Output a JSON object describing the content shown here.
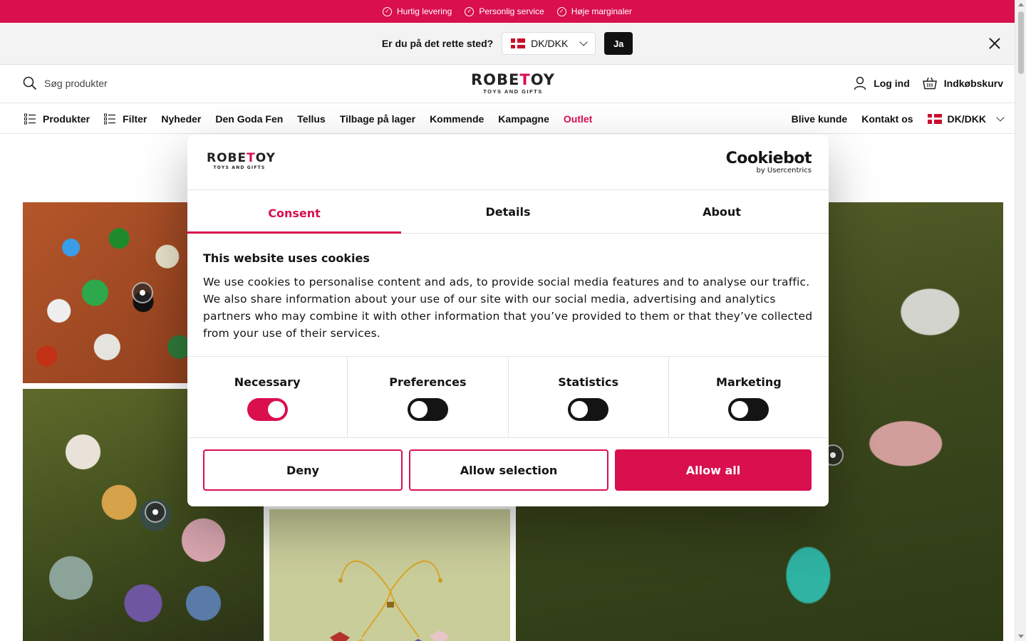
{
  "promo": {
    "items": [
      "Hurtig levering",
      "Personlig service",
      "Høje marginaler"
    ]
  },
  "locale_bar": {
    "question": "Er du på det rette sted?",
    "selected": "DK/DKK",
    "confirm": "Ja"
  },
  "header": {
    "search_placeholder": "Søg produkter",
    "logo_main_left": "ROBE",
    "logo_main_t": "T",
    "logo_main_right": "OY",
    "logo_sub": "TOYS AND GIFTS",
    "login": "Log ind",
    "cart": "Indkøbskurv"
  },
  "nav": {
    "items": [
      "Produkter",
      "Filter",
      "Nyheder",
      "Den Goda Fen",
      "Tellus",
      "Tilbage på lager",
      "Kommende",
      "Kampagne",
      "Outlet"
    ],
    "right": [
      "Blive kunde",
      "Kontakt os"
    ],
    "locale": "DK/DKK"
  },
  "cookie": {
    "provider_main": "Cookiebot",
    "provider_sub": "by Usercentrics",
    "tabs": [
      "Consent",
      "Details",
      "About"
    ],
    "title": "This website uses cookies",
    "text": "We use cookies to personalise content and ads, to provide social media features and to analyse our traffic. We also share information about your use of our site with our social media, advertising and analytics partners who may combine it with other information that you’ve provided to them or that they’ve collected from your use of their services.",
    "categories": [
      {
        "label": "Necessary",
        "on": true
      },
      {
        "label": "Preferences",
        "on": false
      },
      {
        "label": "Statistics",
        "on": false
      },
      {
        "label": "Marketing",
        "on": false
      }
    ],
    "buttons": {
      "deny": "Deny",
      "allow_selection": "Allow selection",
      "allow_all": "Allow all"
    }
  },
  "colors": {
    "brand": "#d90f4e",
    "dark": "#111111"
  }
}
